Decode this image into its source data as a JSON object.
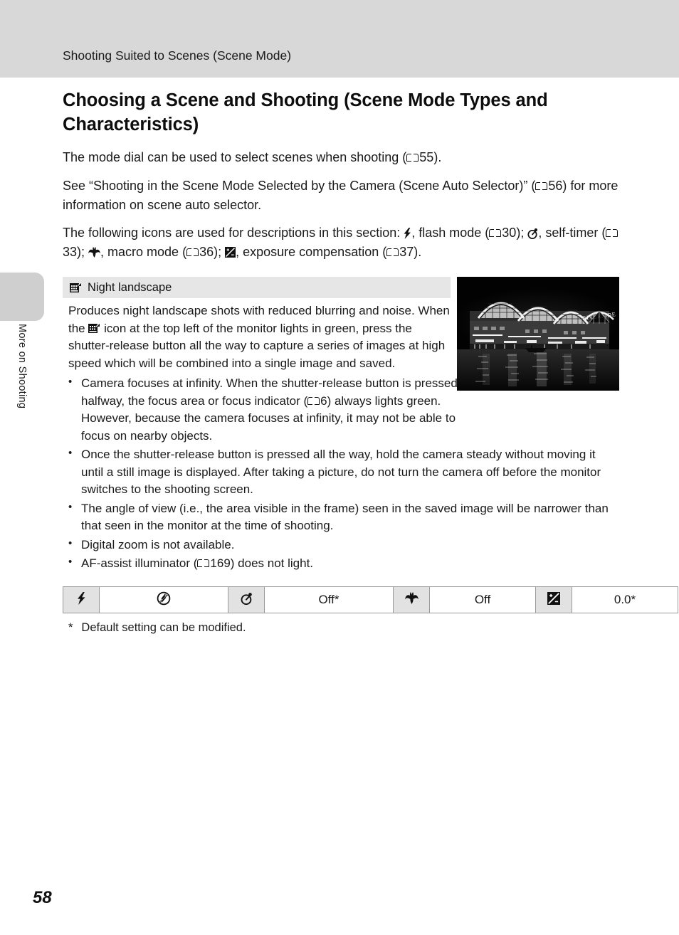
{
  "header": {
    "running_head": "Shooting Suited to Scenes (Scene Mode)"
  },
  "side_tab": {
    "label": "More on Shooting"
  },
  "main": {
    "heading": "Choosing a Scene and Shooting (Scene Mode Types and Characteristics)",
    "paragraphs": {
      "p1_a": "The mode dial can be used to select scenes when shooting (",
      "p1_ref": "55",
      "p1_b": ").",
      "p2_a": "See “Shooting in the Scene Mode Selected by the Camera (Scene Auto Selector)” (",
      "p2_ref": "56",
      "p2_b": ") for more information on scene auto selector.",
      "p3_a": "The following icons are used for descriptions in this section: ",
      "p3_b": ", flash mode (",
      "p3_ref1": "30",
      "p3_c": "); ",
      "p3_d": ", self-timer (",
      "p3_ref2": "33",
      "p3_e": "); ",
      "p3_f": ", macro mode (",
      "p3_ref3": "36",
      "p3_g": "); ",
      "p3_h": ", exposure compensation (",
      "p3_ref4": "37",
      "p3_i": ")."
    }
  },
  "scene": {
    "icon": "night-landscape-icon",
    "name": "Night landscape",
    "description_a": "Produces night landscape shots with reduced blurring and noise. When the ",
    "description_b": " icon at the top left of the monitor lights in green, press the shutter-release button all the way to capture a series of images at high speed which will be combined into a single image and saved.",
    "photo_alt": "Night landscape photo of an illuminated riverside building reflected in water",
    "notes": [
      {
        "text_a": "Camera focuses at infinity. When the shutter-release button is pressed halfway, the focus area or focus indicator (",
        "ref": "6",
        "text_b": ") always lights green. However, because the camera focuses at infinity, it may not be able to focus on nearby objects."
      },
      {
        "text_a": "Once the shutter-release button is pressed all the way, hold the camera steady without moving it until a still image is displayed. After taking a picture, do not turn the camera off before the monitor switches to the shooting screen.",
        "ref": "",
        "text_b": ""
      },
      {
        "text_a": "The angle of view (i.e., the area visible in the frame) seen in the saved image will be narrower than that seen in the monitor at the time of shooting.",
        "ref": "",
        "text_b": ""
      },
      {
        "text_a": "Digital zoom is not available.",
        "ref": "",
        "text_b": ""
      },
      {
        "text_a": "AF-assist illuminator (",
        "ref": "169",
        "text_b": ") does not light."
      }
    ]
  },
  "settings_table": {
    "cells": [
      {
        "icon": "flash-mode-icon",
        "value": "flash-off-icon",
        "value_is_icon": true
      },
      {
        "icon": "self-timer-icon",
        "value": "Off*",
        "value_is_icon": false
      },
      {
        "icon": "macro-mode-icon",
        "value": "Off",
        "value_is_icon": false
      },
      {
        "icon": "exposure-compensation-icon",
        "value": "0.0*",
        "value_is_icon": false
      }
    ]
  },
  "footnote": {
    "marker": "*",
    "text": "Default setting can be modified."
  },
  "page_number": "58",
  "colors": {
    "header_bar": "#d8d8d8",
    "scene_header_bar": "#e6e6e6",
    "table_icon_cell": "#e2e2e2",
    "side_tab": "#cfcfcf"
  }
}
